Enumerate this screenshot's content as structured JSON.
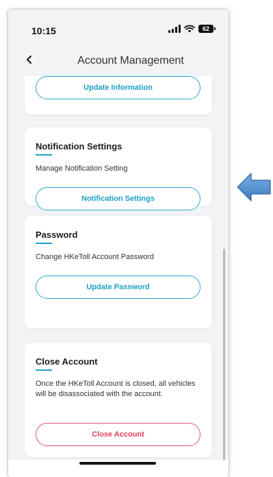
{
  "status_bar": {
    "time": "10:15",
    "battery_level": "62"
  },
  "header": {
    "title": "Account Management"
  },
  "sections": {
    "update_information": {
      "button_label": "Update Information"
    },
    "notification_settings": {
      "title": "Notification Settings",
      "description": "Manage Notification Setting",
      "button_label": "Notification Settings"
    },
    "password": {
      "title": "Password",
      "description": "Change HKeToll Account Password",
      "button_label": "Update Password"
    },
    "close_account": {
      "title": "Close Account",
      "description": "Once the HKeToll Account is closed, all vehicles will be disassociated with the account.",
      "button_label": "Close Account"
    }
  },
  "colors": {
    "accent": "#1aa3c6",
    "danger": "#e0405f",
    "background": "#f2f3f5",
    "annotation_arrow": "#4a86c8"
  },
  "icons": {
    "back": "chevron-left-icon",
    "signal": "cellular-signal-icon",
    "wifi": "wifi-icon",
    "battery": "battery-icon",
    "pointer": "left-arrow-icon"
  }
}
